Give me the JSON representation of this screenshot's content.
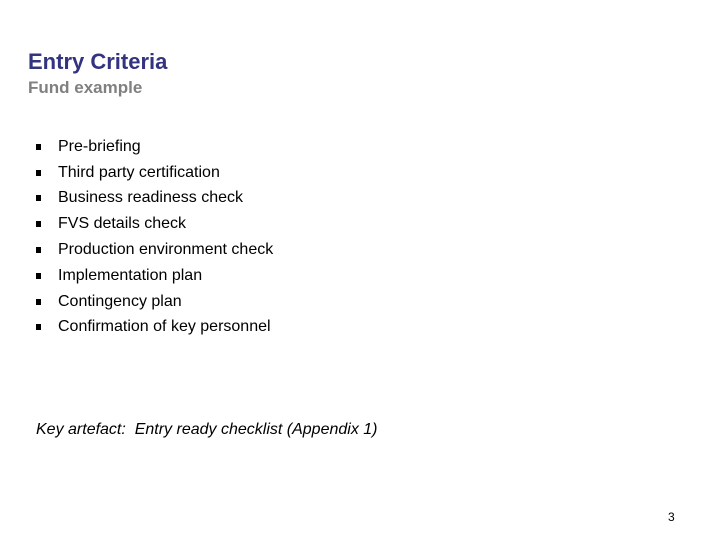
{
  "slide": {
    "title": "Entry Criteria",
    "subtitle": "Fund example",
    "bullets": [
      "Pre-briefing",
      "Third party certification",
      "Business readiness check",
      "FVS details check",
      "Production environment check",
      "Implementation plan",
      "Contingency plan",
      "Confirmation of key personnel"
    ],
    "key_artefact": "Key artefact:  Entry ready checklist (Appendix 1)",
    "page_number": "3"
  },
  "colors": {
    "title": "#333380",
    "subtitle": "#808080"
  }
}
